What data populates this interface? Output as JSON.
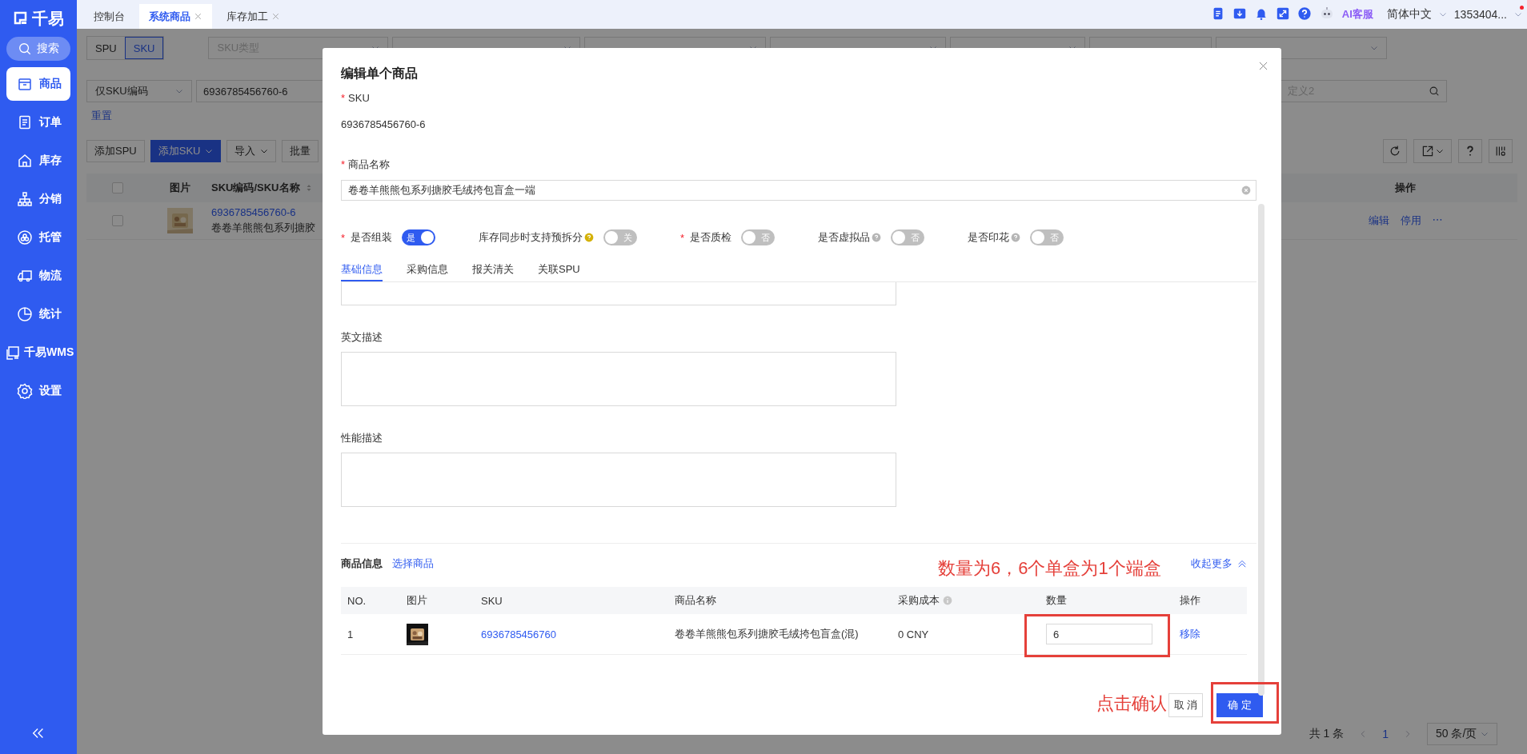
{
  "sidebar": {
    "brand": "千易",
    "search": "搜索",
    "items": [
      {
        "label": "商品",
        "selected": true
      },
      {
        "label": "订单",
        "selected": false
      },
      {
        "label": "库存",
        "selected": false
      },
      {
        "label": "分销",
        "selected": false
      },
      {
        "label": "托管",
        "selected": false
      },
      {
        "label": "物流",
        "selected": false
      },
      {
        "label": "统计",
        "selected": false
      },
      {
        "label": "千易WMS",
        "selected": false
      },
      {
        "label": "设置",
        "selected": false
      }
    ]
  },
  "tabs": [
    {
      "label": "控制台",
      "selected": false,
      "closable": false
    },
    {
      "label": "系统商品",
      "selected": true,
      "closable": true
    },
    {
      "label": "库存加工",
      "selected": false,
      "closable": true
    }
  ],
  "header": {
    "assistant": "AI客服",
    "language": "简体中文",
    "account": "1353404...",
    "unread": true
  },
  "page": {
    "view_toggle": [
      {
        "label": "SPU",
        "selected": false
      },
      {
        "label": "SKU",
        "selected": true
      }
    ],
    "filters": [
      {
        "kind": "select",
        "placeholder": "SKU类型"
      },
      {
        "kind": "select"
      },
      {
        "kind": "select"
      },
      {
        "kind": "select"
      },
      {
        "kind": "select"
      },
      {
        "kind": "plain"
      },
      {
        "kind": "select"
      }
    ],
    "search_scope": "仅SKU编码",
    "search_value": "6936785456760-6",
    "custom_search_placeholder": "定义2",
    "reset": "重置",
    "actions": [
      {
        "label": "添加SPU",
        "kind": "plain",
        "dropdown": false
      },
      {
        "label": "添加SKU",
        "kind": "primary",
        "dropdown": true
      },
      {
        "label": "导入",
        "kind": "plain",
        "dropdown": true
      },
      {
        "label": "批量",
        "kind": "plain",
        "dropdown": false
      }
    ],
    "table": {
      "header_checked": false,
      "columns": [
        "图片",
        "SKU编码/SKU名称",
        "操作"
      ],
      "rows": [
        {
          "checked": false,
          "code": "6936785456760-6",
          "name": "卷卷羊熊熊包系列搪胶",
          "actions": [
            "编辑",
            "停用",
            "⋯"
          ]
        }
      ]
    },
    "pagination": {
      "total": "共 1 条",
      "page": "1",
      "page_size": "50 条/页"
    }
  },
  "modal": {
    "title": "编辑单个商品",
    "sku": {
      "required_mark": "*",
      "label": "SKU",
      "value": "6936785456760-6"
    },
    "name": {
      "required_mark": "*",
      "label": "商品名称",
      "value": "卷卷羊熊熊包系列搪胶毛绒挎包盲盒一端"
    },
    "switches": [
      {
        "required_mark": "*",
        "label": "是否组装",
        "on": true,
        "text": "是"
      },
      {
        "label": "库存同步时支持预拆分",
        "help": {
          "color": "#d4b106"
        },
        "on": false,
        "text": "关"
      },
      {
        "required_mark": "*",
        "label": "是否质检",
        "on": false,
        "text": "否"
      },
      {
        "label": "是否虚拟品",
        "help": {
          "color": "#b5b5b5"
        },
        "on": false,
        "text": "否"
      },
      {
        "label": "是否印花",
        "help": {
          "color": "#b5b5b5"
        },
        "on": false,
        "text": "否"
      }
    ],
    "tabs": [
      {
        "label": "基础信息",
        "selected": true
      },
      {
        "label": "采购信息",
        "selected": false
      },
      {
        "label": "报关清关",
        "selected": false
      },
      {
        "label": "关联SPU",
        "selected": false
      }
    ],
    "descriptions": [
      {
        "label": "英文描述"
      },
      {
        "label": "性能描述"
      }
    ],
    "items_section": {
      "title": "商品信息",
      "pick_link": "选择商品",
      "collapse": "收起更多",
      "columns": [
        "NO.",
        "图片",
        "SKU",
        "商品名称",
        "采购成本",
        "数量",
        "操作"
      ],
      "rows": [
        {
          "no": "1",
          "sku": "6936785456760",
          "name": "卷卷羊熊熊包系列搪胶毛绒挎包盲盒(混)",
          "cost": "0 CNY",
          "quantity": "6",
          "action": "移除"
        }
      ]
    },
    "buttons": [
      {
        "label": "取 消",
        "kind": "default"
      },
      {
        "label": "确 定",
        "kind": "primary"
      }
    ]
  },
  "annotations": [
    {
      "text": "数量为6，6个单盒为1个端盒"
    },
    {
      "text": "点击确认"
    }
  ]
}
